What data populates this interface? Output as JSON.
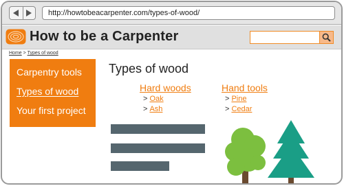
{
  "browser": {
    "url": "http://howtobeacarpenter.com/types-of-wood/"
  },
  "header": {
    "site_title": "How to be a Carpenter",
    "search_placeholder": ""
  },
  "breadcrumb": {
    "home": "Home",
    "separator": ">",
    "current": "Types of wood"
  },
  "sidebar": {
    "items": [
      {
        "label": "Carpentry tools",
        "active": false
      },
      {
        "label": "Types of wood",
        "active": true
      },
      {
        "label": "Your first project",
        "active": false
      }
    ]
  },
  "main": {
    "title": "Types of wood",
    "columns": [
      {
        "heading": "Hard woods",
        "items": [
          "Oak",
          "Ash"
        ]
      },
      {
        "heading": "Hand tools",
        "items": [
          "Pine",
          "Cedar"
        ]
      }
    ],
    "bullet": ">"
  },
  "icons": {
    "back": "back-arrow-icon",
    "forward": "forward-arrow-icon",
    "logo": "wood-grain-logo-icon",
    "search": "magnifier-icon",
    "deciduous_tree": "deciduous-tree-icon",
    "pine_tree": "pine-tree-icon"
  },
  "colors": {
    "accent": "#f07d10",
    "text_placeholder": "#55666e",
    "tree_light": "#7cbf3f",
    "tree_dark": "#1a9e86",
    "trunk": "#6a4a2f"
  }
}
